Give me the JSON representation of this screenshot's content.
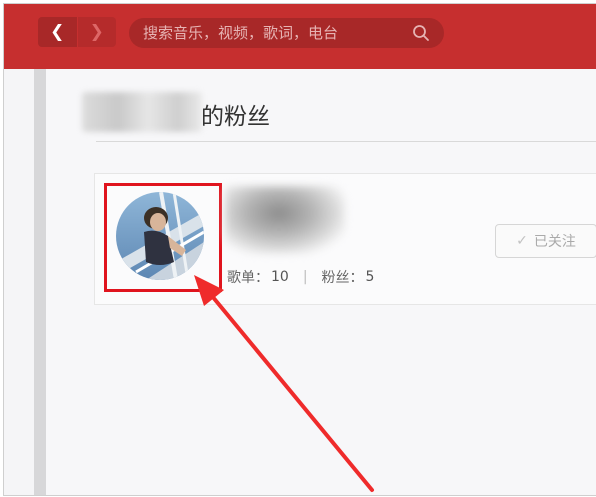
{
  "header": {
    "back_icon": "chevron-left-icon",
    "forward_icon": "chevron-right-icon",
    "search_placeholder": "搜索音乐，视频，歌词，电台",
    "search_icon": "search-icon",
    "brand_color": "#c62f2f"
  },
  "page": {
    "title_suffix": "的粉丝"
  },
  "user_card": {
    "playlists_label": "歌单：",
    "playlists_count": "10",
    "separator": "|",
    "fans_label": "粉丝：",
    "fans_count": "5",
    "follow_label": "已关注",
    "follow_icon": "check-icon"
  },
  "annotation": {
    "highlight_color": "#e0141e"
  }
}
